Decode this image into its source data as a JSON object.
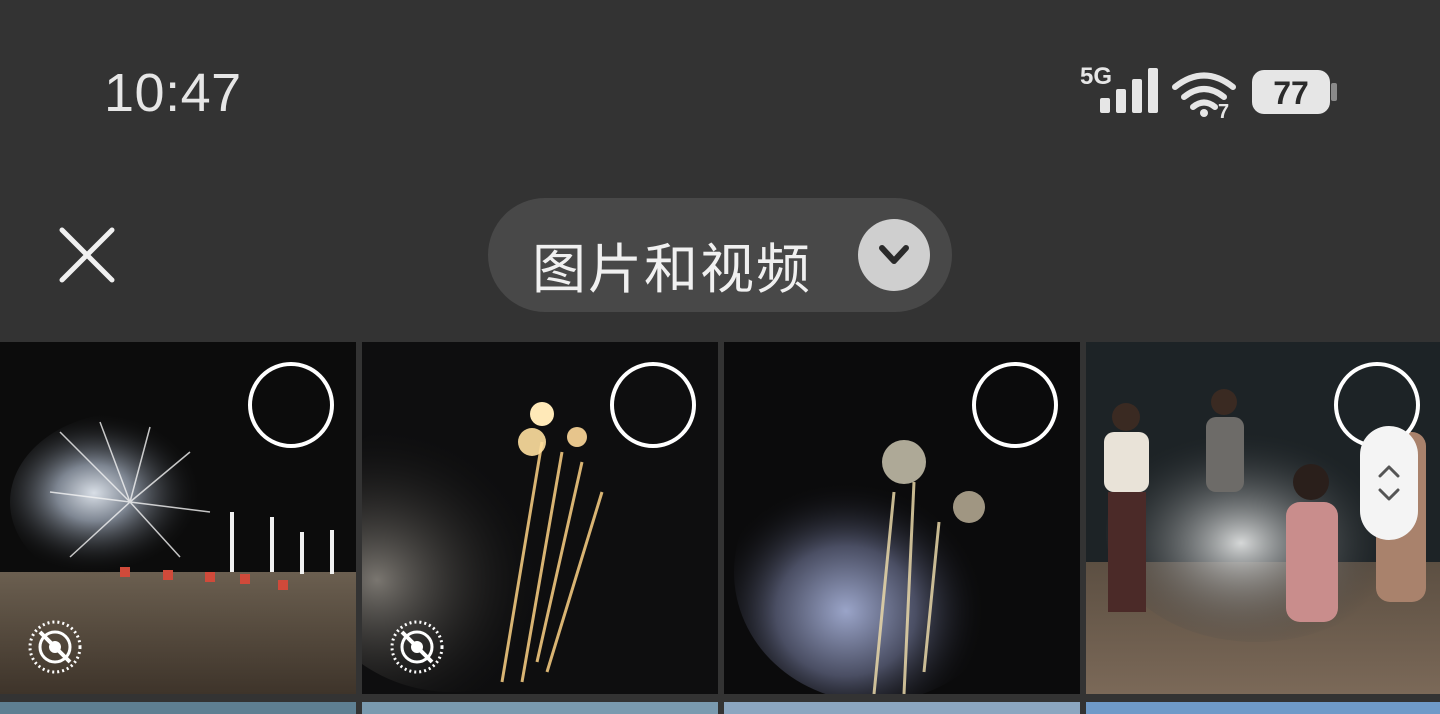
{
  "status_bar": {
    "time": "10:47",
    "network": "5G",
    "wifi_badge": "7",
    "battery": "77",
    "icons": [
      "signal-icon",
      "wifi-icon",
      "battery-icon"
    ]
  },
  "header": {
    "close_icon": "close-icon",
    "album_title": "图片和视频",
    "dropdown_icon": "chevron-down-icon"
  },
  "grid": {
    "items": [
      {
        "kind": "photo",
        "live_off": true,
        "selected": false
      },
      {
        "kind": "photo",
        "live_off": true,
        "selected": false
      },
      {
        "kind": "photo",
        "live_off": false,
        "selected": false
      },
      {
        "kind": "photo",
        "live_off": false,
        "selected": false
      }
    ]
  },
  "scroll_handle": {
    "icon": "scroll-up-down-icon"
  },
  "colors": {
    "background": "#333333",
    "pill": "#484848",
    "chevron_bg": "#cfcfcf"
  }
}
